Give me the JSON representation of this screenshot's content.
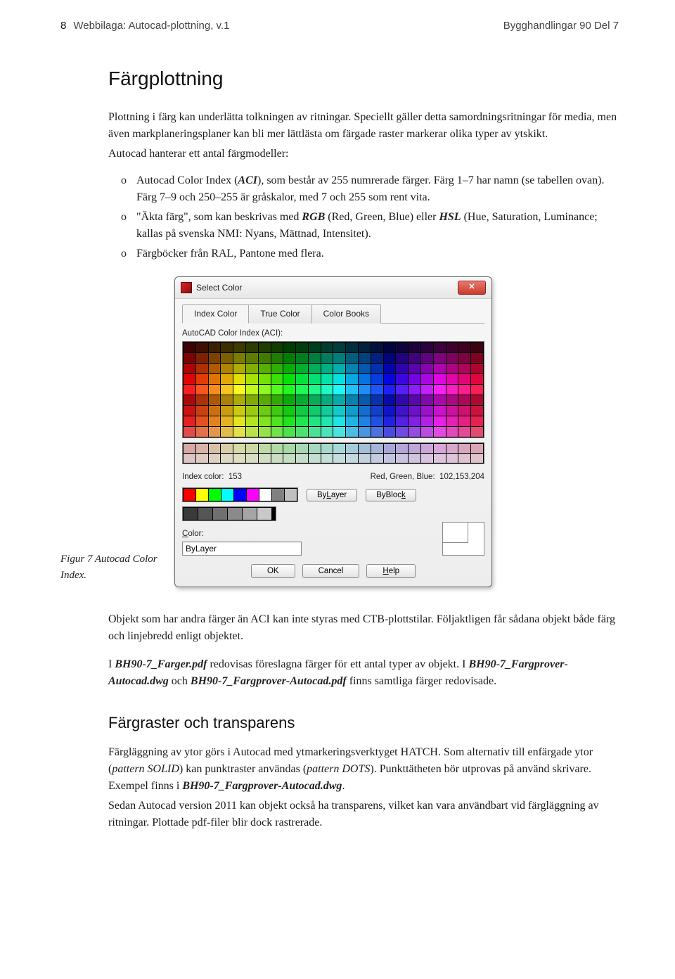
{
  "header": {
    "page_number": "8",
    "doc_left": "Webbilaga: Autocad-plottning, v.1",
    "doc_right": "Bygghandlingar 90 Del 7"
  },
  "section_title": "Färgplottning",
  "para1": "Plottning i färg kan underlätta tolkningen av ritningar. Speciellt gäller detta samordningsritningar för media, men även markplaneringsplaner kan bli mer lättlästa om färgade raster markerar olika typer av ytskikt.",
  "para2_pre": "Autocad hanterar ett antal färgmodeller:",
  "bullets": [
    {
      "pre": "Autocad Color Index (",
      "em": "ACI",
      "post": "), som består av 255 numrerade färger. Färg 1–7 har namn (se tabellen ovan). Färg 7–9 och 250–255 är gråskalor, med 7 och 255 som rent vita."
    },
    {
      "pre": "\"Äkta färg\", som kan beskrivas med ",
      "em": "RGB",
      "mid": " (Red, Green, Blue) eller ",
      "em2": "HSL",
      "post": " (Hue, Saturation, Luminance; kallas på svenska NMI: Nyans, Mättnad, Intensitet)."
    },
    {
      "pre": "Färgböcker från RAL, Pantone med flera.",
      "em": "",
      "post": ""
    }
  ],
  "figure_caption": "Figur 7  Autocad Color Index.",
  "dialog": {
    "title": "Select Color",
    "tabs": [
      "Index Color",
      "True Color",
      "Color Books"
    ],
    "aci_label": "AutoCAD Color Index (ACI):",
    "index_color_label": "Index color:",
    "index_color_value": "153",
    "rgb_label": "Red, Green, Blue:",
    "rgb_value": "102,153,204",
    "bylayer": "ByLayer",
    "byblock": "ByBlock",
    "color_label": "Color:",
    "color_value": "ByLayer",
    "ok": "OK",
    "cancel": "Cancel",
    "help": "Help",
    "std_colors": [
      "#ff0000",
      "#ffff00",
      "#00ff00",
      "#00ffff",
      "#0000ff",
      "#ff00ff",
      "#ffffff",
      "#808080",
      "#c0c0c0"
    ],
    "grays": [
      "#3a3a3a",
      "#555555",
      "#707070",
      "#8a8a8a",
      "#a5a5a5",
      "#c8c8c8"
    ]
  },
  "para3_a": "Objekt som har andra färger än ACI kan inte styras med CTB-plottstilar. Följaktligen får sådana objekt både färg och linjebredd enligt objektet.",
  "para3_b_pre": "I ",
  "para3_b_file1": "BH90-7_Farger.pdf",
  "para3_b_mid1": " redovisas föreslagna färger för ett antal typer av objekt. I ",
  "para3_b_file2": "BH90-7_Fargprover-Autocad.dwg",
  "para3_b_mid2": " och ",
  "para3_b_file3": "BH90-7_Fargprover-Autocad.pdf",
  "para3_b_post": " finns samtliga färger redovisade.",
  "subsection": "Färgraster och transparens",
  "para4_pre": "Färgläggning av ytor görs i Autocad med ytmarkeringsverktyget HATCH. Som alternativ till enfärgade ytor (",
  "para4_em1": "pattern SOLID",
  "para4_mid1": ") kan punktraster användas (",
  "para4_em2": "pattern DOTS",
  "para4_mid2": "). Punkttätheten bör utprovas på använd skrivare. Exempel finns i ",
  "para4_file": "BH90-7_Fargprover-Autocad.dwg",
  "para4_post": ".",
  "para5": "Sedan Autocad version 2011 kan objekt också ha transparens, vilket kan vara användbart vid färgläggning av ritningar. Plottade pdf-filer blir dock rastrerade."
}
